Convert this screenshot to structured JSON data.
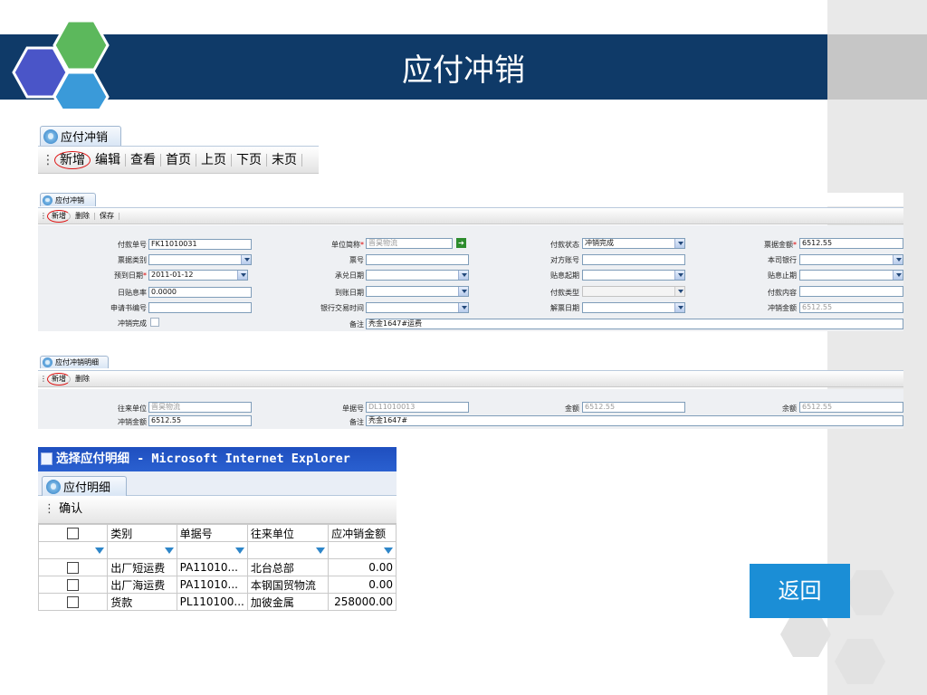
{
  "title": "应付冲销",
  "back_label": "返回",
  "top_panel": {
    "tab": "应付冲销",
    "toolbar": [
      "新增",
      "编辑",
      "查看",
      "首页",
      "上页",
      "下页",
      "末页"
    ]
  },
  "form_panel": {
    "tab": "应付冲销",
    "toolbar": [
      "新增",
      "删除",
      "保存"
    ],
    "fields": {
      "fkdh_label": "付款单号",
      "fkdh_value": "FK11010031",
      "dwjc_label": "单位简称",
      "dwjc_value": "晋昊物流",
      "fkzt_label": "付款状态",
      "fkzt_value": "冲销完成",
      "pjje_label": "票据金额",
      "pjje_value": "6512.55",
      "pjlb_label": "票据类别",
      "ph_label": "票号",
      "dfzh_label": "对方账号",
      "bsyh_label": "本司银行",
      "ydrq_label": "预到日期",
      "ydrq_value": "2011-01-12",
      "cdrq_label": "承兑日期",
      "txqq_label": "贴息起期",
      "txzq_label": "贴息止期",
      "rtxl_label": "日贴息率",
      "rtxl_value": "0.0000",
      "dzrq_label": "到账日期",
      "fklx_label": "付款类型",
      "fknr_label": "付款内容",
      "sqsbh_label": "申请书编号",
      "yhjysj_label": "银行交易时间",
      "jprq_label": "解票日期",
      "cxje_label": "冲销金额",
      "cxje_value": "6512.55",
      "cxwc_label": "冲销完成",
      "bz_label": "备注",
      "bz_value": "秃金1647#运费"
    }
  },
  "detail_panel": {
    "tab": "应付冲销明细",
    "toolbar": [
      "新增",
      "删除"
    ],
    "fields": {
      "wldw_label": "往来单位",
      "wldw_value": "晋昊物流",
      "djh_label": "单据号",
      "djh_value": "DL11010013",
      "je_label": "金额",
      "je_value": "6512.55",
      "ye_label": "余额",
      "ye_value": "6512.55",
      "cxje_label": "冲销金额",
      "cxje_value": "6512.55",
      "bz_label": "备注",
      "bz_value": "秃金1647#"
    }
  },
  "popup": {
    "caption": "选择应付明细 - Microsoft Internet Explorer",
    "tab": "应付明细",
    "toolbar": [
      "确认"
    ],
    "columns": [
      "类别",
      "单据号",
      "往来单位",
      "应冲销金额"
    ],
    "rows": [
      {
        "category": "出厂短运费",
        "doc": "PA11010...",
        "unit": "北台总部",
        "amount": "0.00"
      },
      {
        "category": "出厂海运费",
        "doc": "PA11010...",
        "unit": "本钢国贸物流",
        "amount": "0.00"
      },
      {
        "category": "货款",
        "doc": "PL110100...",
        "unit": "加彼金属",
        "amount": "258000.00"
      }
    ]
  },
  "colors": {
    "header_bg": "#0f3a68",
    "back_button": "#1b8ed6",
    "hex_blue": "#4a55c8",
    "hex_green": "#5cb85c",
    "hex_sky": "#3a9ad9"
  }
}
